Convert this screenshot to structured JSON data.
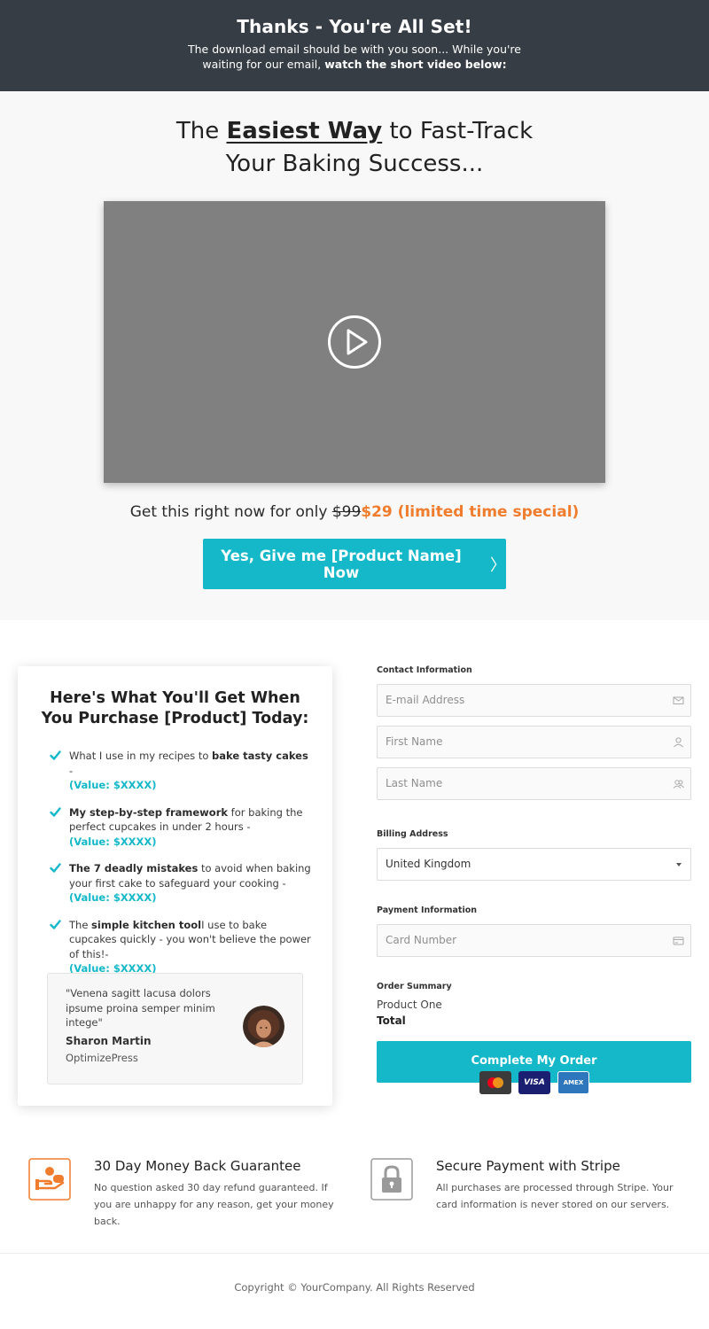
{
  "topbar": {
    "title": "Thanks - You're All Set!",
    "text": "The download email should be with you soon... While you're waiting for our email,",
    "text_bold": "watch the short video below:"
  },
  "hero": {
    "headline_pre": "The",
    "headline_em": "Easiest Way",
    "headline_post": "to Fast-Track Your Baking Success...",
    "price_prefix": "Get this right now for only",
    "price_old": "$99",
    "price_new": "$29 (limited time special)",
    "cta_label": "Yes, Give me [Product Name] Now",
    "cta_chevron": "〉"
  },
  "card": {
    "title": "Here's What You'll Get When You Purchase [Product] Today:",
    "bullets": [
      {
        "pre": "What I use in my recipes to ",
        "bold": "bake tasty cakes",
        "post": " -",
        "value": "(Value: $XXXX)"
      },
      {
        "pre": "",
        "bold": "My step-by-step framework",
        "post": " for baking the perfect cupcakes in under 2 hours -",
        "value": "(Value: $XXXX)"
      },
      {
        "pre": "",
        "bold": "The 7 deadly mistakes",
        "post": " to avoid when baking your first cake to safeguard your cooking -",
        "value": "(Value: $XXXX)"
      },
      {
        "pre": "The ",
        "bold": "simple kitchen tool",
        "post": "I use to bake cupcakes quickly - you won't believe the power of this!-",
        "value": "(Value: $XXXX)"
      }
    ],
    "testimonial": {
      "quote": "\"Venena sagitt lacusa dolors ipsume proina semper minim intege\"",
      "name": "Sharon Martin",
      "company": "OptimizePress"
    }
  },
  "form": {
    "contact_heading": "Contact Information",
    "email_placeholder": "E-mail Address",
    "first_name_placeholder": "First Name",
    "last_name_placeholder": "Last Name",
    "billing_heading": "Billing Address",
    "country_value": "United Kingdom",
    "payment_heading": "Payment Information",
    "card_placeholder": "Card Number",
    "summary_heading": "Order Summary",
    "summary_product": "Product One",
    "summary_total": "Total",
    "submit_label": "Complete My Order",
    "card_brands": [
      "mastercard",
      "VISA",
      "AMEX"
    ]
  },
  "guarantees": [
    {
      "icon": "money-back-hand-icon",
      "title": "30 Day Money Back Guarantee",
      "text": "No question asked 30 day refund guaranteed. If you are unhappy for any reason, get your money back."
    },
    {
      "icon": "lock-icon",
      "title": "Secure Payment with Stripe",
      "text": "All purchases are processed through Stripe.  Your card information is never stored on our servers."
    }
  ],
  "footer": {
    "copyright": "Copyright © YourCompany. All Rights Reserved"
  },
  "colors": {
    "accent": "#14b8c8",
    "orange": "#f07c2e",
    "topbar": "#363d44",
    "video": "#808080"
  }
}
